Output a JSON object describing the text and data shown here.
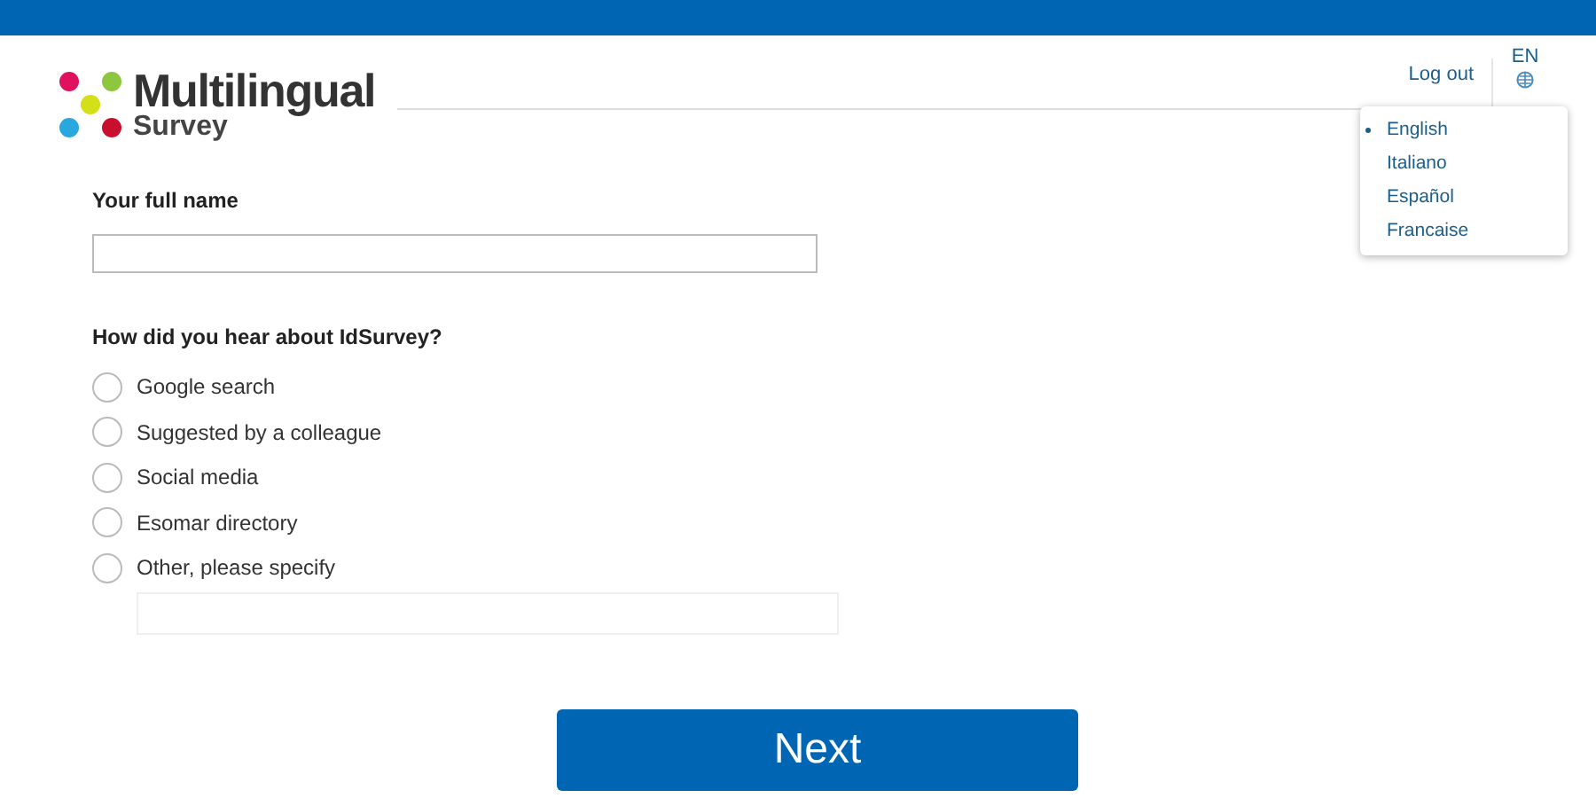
{
  "logo": {
    "title": "Multilingual",
    "subtitle": "Survey"
  },
  "header": {
    "logout": "Log out",
    "language": "EN"
  },
  "language_menu": [
    {
      "label": "English",
      "selected": true
    },
    {
      "label": "Italiano",
      "selected": false
    },
    {
      "label": "Español",
      "selected": false
    },
    {
      "label": "Francaise",
      "selected": false
    }
  ],
  "name_field": {
    "label": "Your full name"
  },
  "question": {
    "label": "How did you hear about IdSurvey?",
    "options": [
      {
        "label": "Google search",
        "selected": false
      },
      {
        "label": "Suggested by a colleague",
        "selected": false
      },
      {
        "label": "Social media",
        "selected": false
      },
      {
        "label": "Esomar directory",
        "selected": false
      },
      {
        "label": "Other, please specify",
        "selected": false
      }
    ]
  },
  "next_button": "Next"
}
